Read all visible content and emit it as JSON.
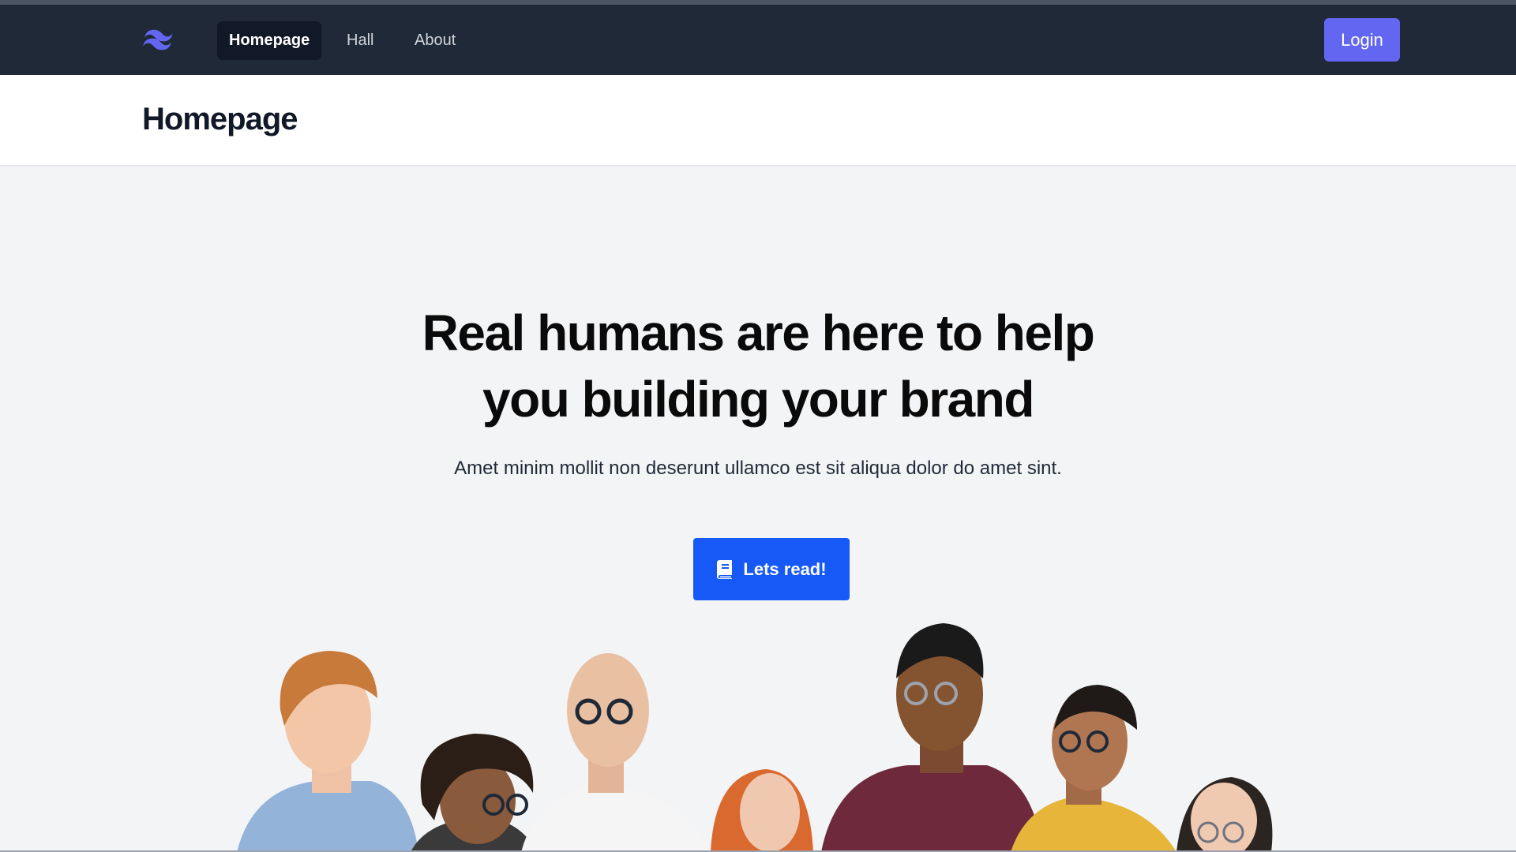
{
  "nav": {
    "logo": "tailwind-logo-icon",
    "links": [
      "Homepage",
      "Hall",
      "About"
    ],
    "active": "Homepage",
    "login_label": "Login"
  },
  "header": {
    "title": "Homepage"
  },
  "hero": {
    "title_line1": "Real humans are here to help",
    "title_line2": "you building your brand",
    "subtitle": "Amet minim mollit non deserunt ullamco est sit aliqua dolor do amet sint.",
    "cta_label": "Lets read!",
    "cta_icon": "book-icon"
  },
  "colors": {
    "navbar": "#1f2937",
    "login": "#6366f1",
    "cta": "#1659f7",
    "background": "#f3f4f6"
  }
}
